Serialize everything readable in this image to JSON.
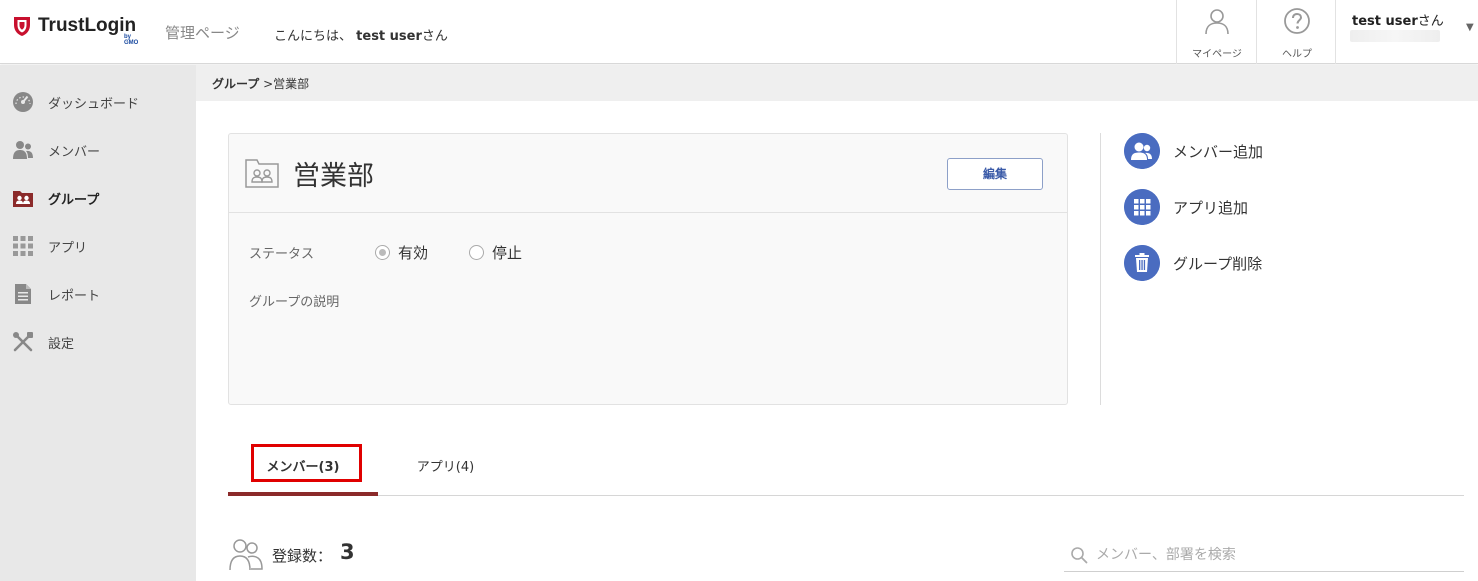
{
  "header": {
    "brand": "TrustLogin",
    "brand_sub": "by GMO",
    "admin_title": "管理ページ",
    "greeting_prefix": "こんにちは、",
    "greeting_user": "test user",
    "greeting_suffix": "さん",
    "mypage_label": "マイページ",
    "help_label": "ヘルプ",
    "user_name": "test user",
    "user_suffix": "さん"
  },
  "sidebar": {
    "items": [
      {
        "label": "ダッシュボード",
        "icon": "gauge-icon"
      },
      {
        "label": "メンバー",
        "icon": "members-icon"
      },
      {
        "label": "グループ",
        "icon": "group-icon",
        "active": true
      },
      {
        "label": "アプリ",
        "icon": "grid-icon"
      },
      {
        "label": "レポート",
        "icon": "document-icon"
      },
      {
        "label": "設定",
        "icon": "tools-icon"
      }
    ]
  },
  "breadcrumb": {
    "parent": "グループ",
    "separator": ">",
    "current": "営業部"
  },
  "group": {
    "name": "営業部",
    "edit_label": "編集",
    "status_label": "ステータス",
    "status_options": [
      "有効",
      "停止"
    ],
    "status_selected": "有効",
    "description_label": "グループの説明"
  },
  "actions": [
    {
      "label": "メンバー追加",
      "icon": "add-member-icon"
    },
    {
      "label": "アプリ追加",
      "icon": "add-app-icon"
    },
    {
      "label": "グループ削除",
      "icon": "trash-icon"
    }
  ],
  "tabs": [
    {
      "label": "メンバー(3)",
      "active": true
    },
    {
      "label": "アプリ(4)",
      "active": false
    }
  ],
  "members": {
    "count_label": "登録数：",
    "count_value": "3",
    "search_placeholder": "メンバー、部署を検索"
  },
  "colors": {
    "accent": "#4a6cc0",
    "logo_red": "#c8102e",
    "tab_underline": "#8b2a2a",
    "highlight": "#e00000"
  }
}
